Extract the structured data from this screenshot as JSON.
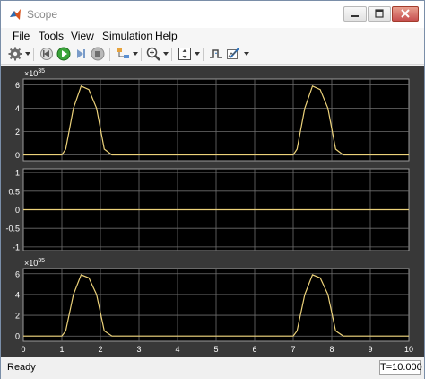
{
  "window": {
    "title": "Scope"
  },
  "menu": [
    "File",
    "Tools",
    "View",
    "Simulation",
    "Help"
  ],
  "toolbar": {
    "icons": [
      "settings-icon",
      "step-back-icon",
      "run-icon",
      "step-forward-icon",
      "stop-icon",
      "highlight-icon",
      "zoom-in-icon",
      "fit-to-view-icon",
      "triggers-icon"
    ]
  },
  "colors": {
    "plot_background": "#000000",
    "figure_background": "#383838",
    "signal": "#ecd27a",
    "grid": "#6e6e6e",
    "axis_text": "#ffffff"
  },
  "status": {
    "text": "Ready",
    "time": "T=10.000"
  },
  "chart_data": [
    {
      "type": "line",
      "ylim": [
        -0.5,
        6.5
      ],
      "yticks": [
        "0",
        "2",
        "4",
        "6"
      ],
      "exponent": "×10",
      "exponent_power": "35",
      "xlim": [
        0,
        10
      ],
      "xticks": [],
      "grid": true,
      "series": [
        {
          "x": [
            0,
            1,
            1.1,
            1.3,
            1.5,
            1.7,
            1.9,
            2.1,
            2.3,
            7.0,
            7.1,
            7.3,
            7.5,
            7.7,
            7.9,
            8.1,
            8.3,
            10
          ],
          "y": [
            0,
            0,
            0.5,
            4.0,
            5.9,
            5.6,
            4.0,
            0.5,
            0,
            0,
            0.5,
            4.0,
            5.9,
            5.6,
            4.0,
            0.5,
            0,
            0
          ]
        }
      ]
    },
    {
      "type": "line",
      "ylim": [
        -1.1,
        1.1
      ],
      "yticks": [
        "-1",
        "-0.5",
        "0",
        "0.5",
        "1"
      ],
      "xlim": [
        0,
        10
      ],
      "xticks": [],
      "grid": true,
      "series": [
        {
          "x": [
            0,
            10
          ],
          "y": [
            0,
            0
          ]
        }
      ]
    },
    {
      "type": "line",
      "ylim": [
        -0.5,
        6.5
      ],
      "yticks": [
        "0",
        "2",
        "4",
        "6"
      ],
      "exponent": "×10",
      "exponent_power": "35",
      "xlim": [
        0,
        10
      ],
      "xticks": [
        "0",
        "1",
        "2",
        "3",
        "4",
        "5",
        "6",
        "7",
        "8",
        "9",
        "10"
      ],
      "grid": true,
      "series": [
        {
          "x": [
            0,
            1,
            1.1,
            1.3,
            1.5,
            1.7,
            1.9,
            2.1,
            2.3,
            7.0,
            7.1,
            7.3,
            7.5,
            7.7,
            7.9,
            8.1,
            8.3,
            10
          ],
          "y": [
            0,
            0,
            0.5,
            4.0,
            5.9,
            5.6,
            4.0,
            0.5,
            0,
            0,
            0.5,
            4.0,
            5.9,
            5.6,
            4.0,
            0.5,
            0,
            0
          ]
        }
      ]
    }
  ]
}
